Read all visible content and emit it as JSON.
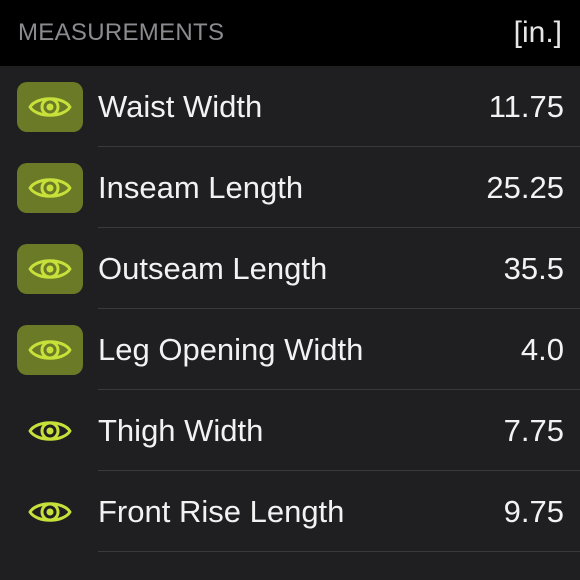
{
  "header": {
    "title": "MEASUREMENTS",
    "unit": "[in.]"
  },
  "colors": {
    "accent": "#c8e03a",
    "icon_bg_active": "#6a7a26",
    "background": "#1f1f21",
    "header_bg": "#000000"
  },
  "measurements": [
    {
      "label": "Waist Width",
      "value": "11.75",
      "icon": "eye-icon",
      "highlighted": true
    },
    {
      "label": "Inseam Length",
      "value": "25.25",
      "icon": "eye-icon",
      "highlighted": true
    },
    {
      "label": "Outseam Length",
      "value": "35.5",
      "icon": "eye-icon",
      "highlighted": true
    },
    {
      "label": "Leg Opening Width",
      "value": "4.0",
      "icon": "eye-icon",
      "highlighted": true
    },
    {
      "label": "Thigh Width",
      "value": "7.75",
      "icon": "eye-icon",
      "highlighted": false
    },
    {
      "label": "Front Rise Length",
      "value": "9.75",
      "icon": "eye-icon",
      "highlighted": false
    }
  ]
}
